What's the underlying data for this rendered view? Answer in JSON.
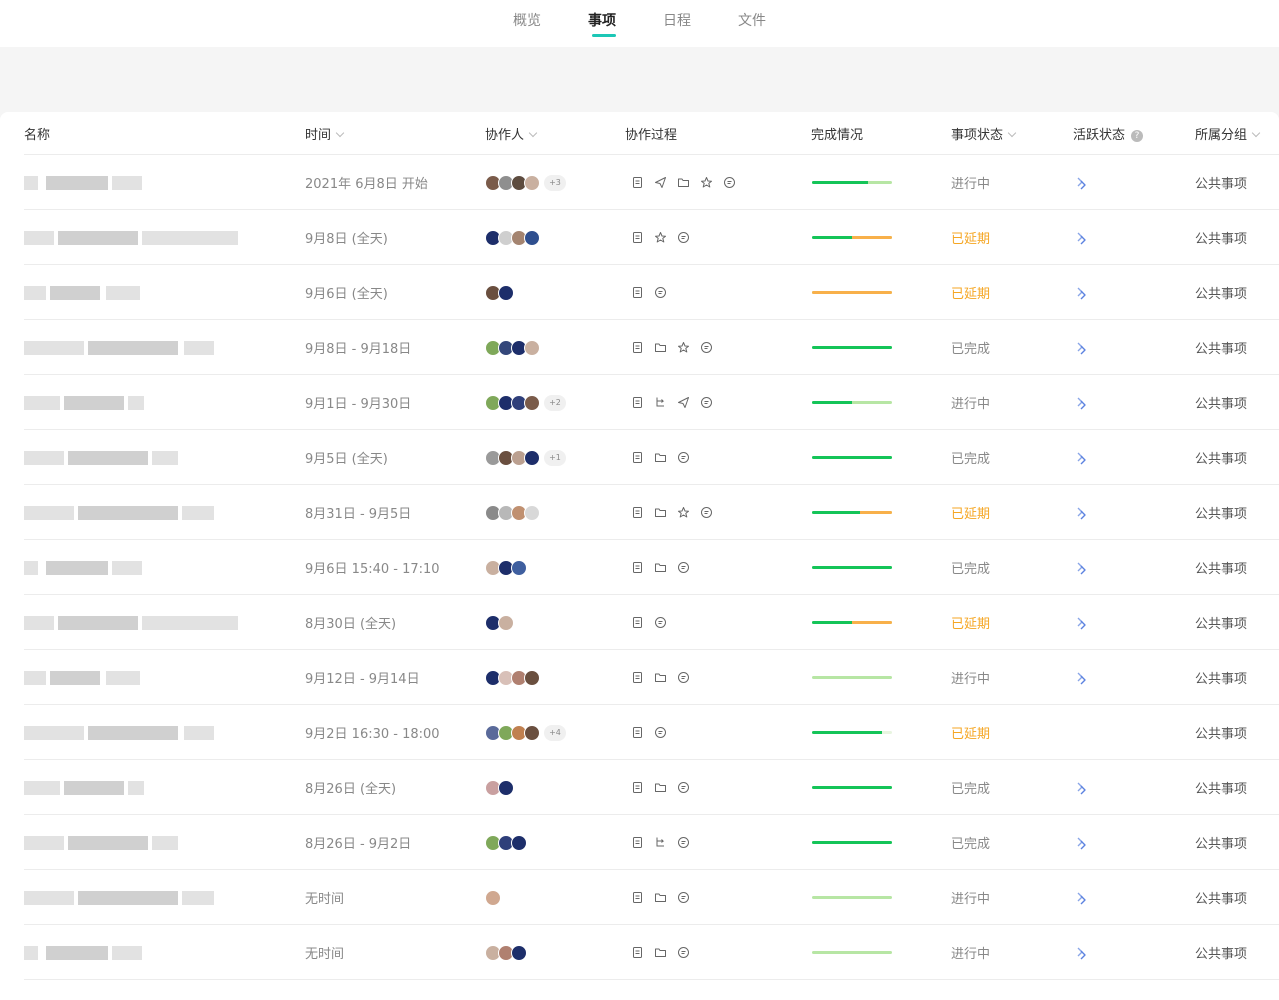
{
  "tabs": [
    {
      "label": "概览",
      "active": false
    },
    {
      "label": "事项",
      "active": true
    },
    {
      "label": "日程",
      "active": false
    },
    {
      "label": "文件",
      "active": false
    }
  ],
  "columns": {
    "name": "名称",
    "time": "时间",
    "collaborators": "协作人",
    "process": "协作过程",
    "progress": "完成情况",
    "status": "事项状态",
    "activity": "活跃状态",
    "group": "所属分组"
  },
  "colors": {
    "accent": "#1cc7b6",
    "progress_done": "#14c458",
    "progress_late": "#f8b04a",
    "progress_track": "#b7e6a4",
    "late_text": "#f5a623"
  },
  "rows": [
    {
      "time": "2021年 6月8日 开始",
      "avatars": [
        "#7a5b4a",
        "#8f8f8f",
        "#5d4c3f",
        "#c9b0a0"
      ],
      "more": "+3",
      "icons": [
        "doc",
        "send",
        "folder",
        "star",
        "chat"
      ],
      "done": 0.7,
      "late": 0,
      "status": "进行中",
      "late_status": false,
      "activity": true,
      "group": "公共事项"
    },
    {
      "time": "9月8日 (全天)",
      "avatars": [
        "#1d2e6a",
        "#cfcfcf",
        "#a48470",
        "#2f4f8f"
      ],
      "more": "",
      "icons": [
        "doc",
        "star",
        "chat"
      ],
      "done": 0.5,
      "late": 0.5,
      "status": "已延期",
      "late_status": true,
      "activity": true,
      "group": "公共事项"
    },
    {
      "time": "9月6日 (全天)",
      "avatars": [
        "#6a4f3f",
        "#1d2e6a"
      ],
      "more": "",
      "icons": [
        "doc",
        "chat"
      ],
      "done": 0,
      "late": 1,
      "status": "已延期",
      "late_status": true,
      "activity": true,
      "group": "公共事项"
    },
    {
      "time": "9月8日 - 9月18日",
      "avatars": [
        "#7fa85a",
        "#34477a",
        "#1d2e6a",
        "#c9b0a0"
      ],
      "more": "",
      "icons": [
        "doc",
        "folder",
        "star",
        "chat"
      ],
      "done": 1,
      "late": 0,
      "status": "已完成",
      "late_status": false,
      "activity": true,
      "group": "公共事项"
    },
    {
      "time": "9月1日 - 9月30日",
      "avatars": [
        "#7fa85a",
        "#1d2e6a",
        "#2f3f7a",
        "#7a5b4a"
      ],
      "more": "+2",
      "icons": [
        "doc",
        "flow",
        "send",
        "chat"
      ],
      "done": 0.5,
      "late": 0,
      "status": "进行中",
      "late_status": false,
      "activity": true,
      "group": "公共事项"
    },
    {
      "time": "9月5日 (全天)",
      "avatars": [
        "#9a9a9a",
        "#6a4f3f",
        "#bba090",
        "#1d2e6a"
      ],
      "more": "+1",
      "icons": [
        "doc",
        "folder",
        "chat"
      ],
      "done": 1,
      "late": 0,
      "status": "已完成",
      "late_status": false,
      "activity": true,
      "group": "公共事项"
    },
    {
      "time": "8月31日 - 9月5日",
      "avatars": [
        "#8a8a8a",
        "#b8b8b8",
        "#c09070",
        "#d8d8d8"
      ],
      "more": "",
      "icons": [
        "doc",
        "folder",
        "star",
        "chat"
      ],
      "done": 0.6,
      "late": 0.4,
      "status": "已延期",
      "late_status": true,
      "activity": true,
      "group": "公共事项"
    },
    {
      "time": "9月6日 15:40 - 17:10",
      "avatars": [
        "#c9b0a0",
        "#1d2e6a",
        "#3f5f9f"
      ],
      "more": "",
      "icons": [
        "doc",
        "folder",
        "chat"
      ],
      "done": 1,
      "late": 0,
      "status": "已完成",
      "late_status": false,
      "activity": true,
      "group": "公共事项"
    },
    {
      "time": "8月30日 (全天)",
      "avatars": [
        "#1d2e6a",
        "#c9b0a0"
      ],
      "more": "",
      "icons": [
        "doc",
        "chat"
      ],
      "done": 0.5,
      "late": 0.5,
      "status": "已延期",
      "late_status": true,
      "activity": true,
      "group": "公共事项"
    },
    {
      "time": "9月12日 - 9月14日",
      "avatars": [
        "#1d2e6a",
        "#d8c0b8",
        "#b08070",
        "#6a4f3f"
      ],
      "more": "",
      "icons": [
        "doc",
        "folder",
        "chat"
      ],
      "done": 0,
      "late": 0,
      "status": "进行中",
      "late_status": false,
      "activity": true,
      "group": "公共事项"
    },
    {
      "time": "9月2日 16:30 - 18:00",
      "avatars": [
        "#5a6a9a",
        "#7fa85a",
        "#c08050",
        "#6a4f3f"
      ],
      "more": "+4",
      "icons": [
        "doc",
        "chat"
      ],
      "done": 0.88,
      "late": 0,
      "status": "已延期",
      "late_status": true,
      "activity": false,
      "group": "公共事项"
    },
    {
      "time": "8月26日 (全天)",
      "avatars": [
        "#c9a0a0",
        "#1d2e6a"
      ],
      "more": "",
      "icons": [
        "doc",
        "folder",
        "chat"
      ],
      "done": 1,
      "late": 0,
      "status": "已完成",
      "late_status": false,
      "activity": true,
      "group": "公共事项"
    },
    {
      "time": "8月26日 - 9月2日",
      "avatars": [
        "#7fa85a",
        "#2f3f7a",
        "#1d2e6a"
      ],
      "more": "",
      "icons": [
        "doc",
        "flow",
        "chat"
      ],
      "done": 1,
      "late": 0,
      "status": "已完成",
      "late_status": false,
      "activity": true,
      "group": "公共事项"
    },
    {
      "time": "无时间",
      "avatars": [
        "#d0a890"
      ],
      "more": "",
      "icons": [
        "doc",
        "folder",
        "chat"
      ],
      "done": 0,
      "late": 0,
      "status": "进行中",
      "late_status": false,
      "activity": true,
      "group": "公共事项"
    },
    {
      "time": "无时间",
      "avatars": [
        "#c9b0a0",
        "#b08070",
        "#1d2e6a"
      ],
      "more": "",
      "icons": [
        "doc",
        "folder",
        "chat"
      ],
      "done": 0,
      "late": 0,
      "status": "进行中",
      "late_status": false,
      "activity": true,
      "group": "公共事项"
    }
  ]
}
